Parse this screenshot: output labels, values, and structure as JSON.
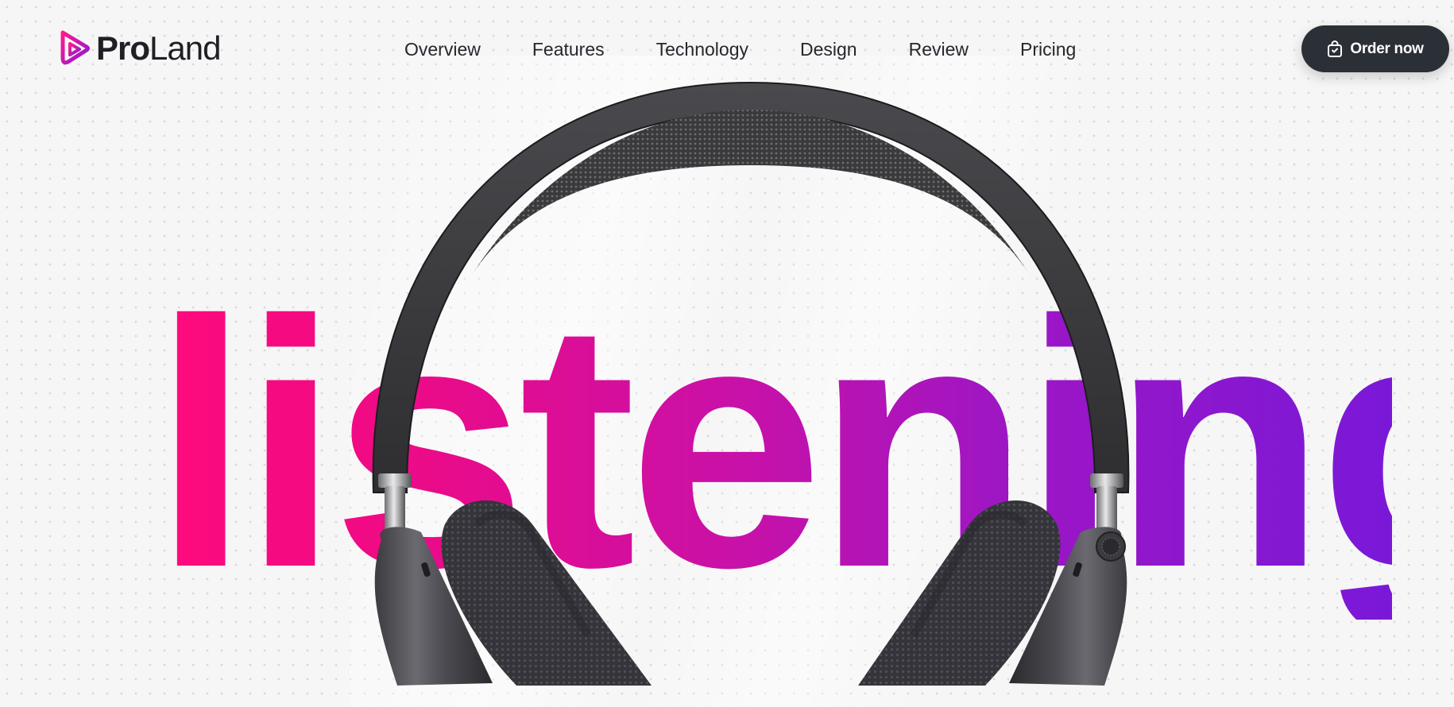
{
  "brand": {
    "name_strong": "Pro",
    "name_light": "Land",
    "logo_icon": "play-triangle-logo-icon",
    "gradient_colors": [
      "#ff1a8c",
      "#7a18d8"
    ]
  },
  "nav": {
    "items": [
      {
        "label": "Overview"
      },
      {
        "label": "Features"
      },
      {
        "label": "Technology"
      },
      {
        "label": "Design"
      },
      {
        "label": "Review"
      },
      {
        "label": "Pricing"
      }
    ]
  },
  "cta": {
    "label": "Order now",
    "icon": "shopping-bag-icon",
    "background": "#2b2f36"
  },
  "hero": {
    "word": "listening",
    "gradient_start": "#ff0a7d",
    "gradient_end": "#7a18d8",
    "product_image": "headphones-image"
  }
}
